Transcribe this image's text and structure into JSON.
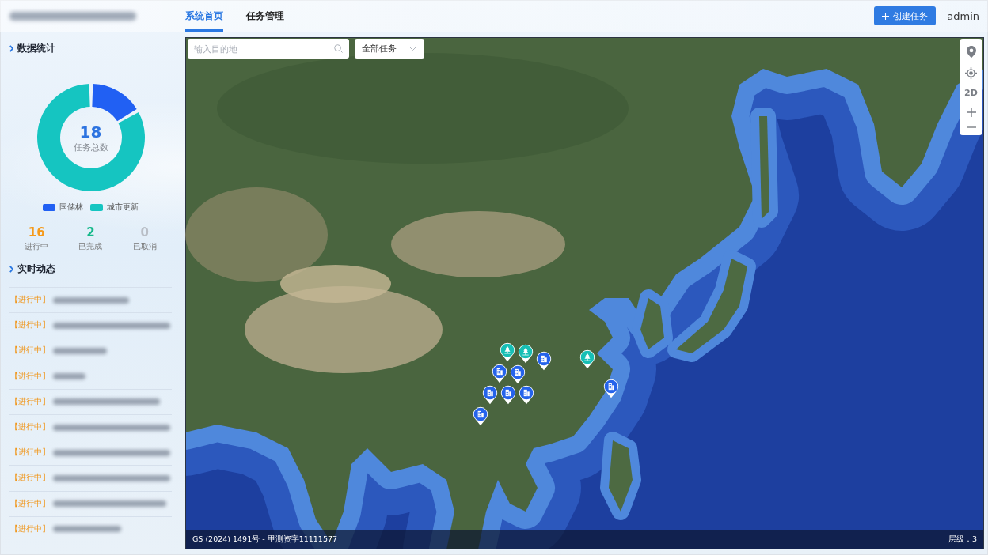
{
  "header": {
    "tabs": [
      {
        "label": "系统首页",
        "selected": true
      },
      {
        "label": "任务管理",
        "selected": false
      }
    ],
    "create_button": {
      "label": "创建任务"
    },
    "user": "admin"
  },
  "stats": {
    "title": "数据统计",
    "total": "18",
    "total_label": "任务总数",
    "legend": [
      {
        "label": "国储林",
        "color": "#2160f3"
      },
      {
        "label": "城市更新",
        "color": "#15c5c1"
      }
    ],
    "counts": [
      {
        "value": "16",
        "label": "进行中",
        "color": "#f59a1b"
      },
      {
        "value": "2",
        "label": "已完成",
        "color": "#16b98a"
      },
      {
        "value": "0",
        "label": "已取消",
        "color": "#b9bec6"
      }
    ]
  },
  "activity": {
    "title": "实时动态",
    "items": [
      {
        "status": "【进行中】"
      },
      {
        "status": "【进行中】"
      },
      {
        "status": "【进行中】"
      },
      {
        "status": "【进行中】"
      },
      {
        "status": "【进行中】"
      },
      {
        "status": "【进行中】"
      },
      {
        "status": "【进行中】"
      },
      {
        "status": "【进行中】"
      },
      {
        "status": "【进行中】"
      },
      {
        "status": "【进行中】"
      }
    ]
  },
  "map": {
    "search": {
      "placeholder": "输入目的地"
    },
    "filter": {
      "value": "全部任务"
    },
    "controls": {
      "view_mode": "2D"
    },
    "markers": [
      {
        "kind": "tree",
        "color": "#17bfb5"
      },
      {
        "kind": "tree",
        "color": "#17bfb5"
      },
      {
        "kind": "building",
        "color": "#2563eb"
      },
      {
        "kind": "building",
        "color": "#2563eb"
      },
      {
        "kind": "building",
        "color": "#2563eb"
      },
      {
        "kind": "building",
        "color": "#2563eb"
      },
      {
        "kind": "building",
        "color": "#2563eb"
      },
      {
        "kind": "building",
        "color": "#2563eb"
      },
      {
        "kind": "building",
        "color": "#2563eb"
      },
      {
        "kind": "tree",
        "color": "#17bfb5"
      },
      {
        "kind": "building",
        "color": "#2563eb"
      }
    ],
    "copyright": "GS (2024) 1491号 - 甲测资字11111577",
    "zoom_level": "层级：3"
  }
}
